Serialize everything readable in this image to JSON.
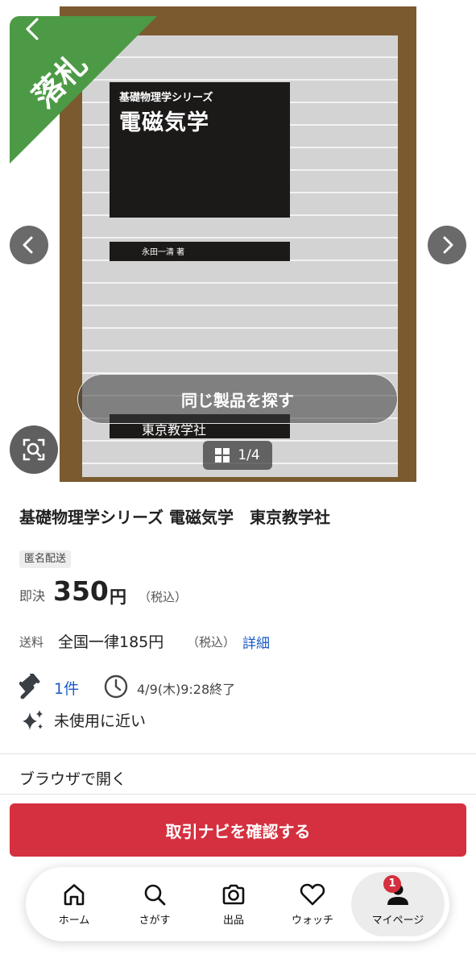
{
  "gallery": {
    "sold_badge": "落札",
    "book": {
      "series": "基礎物理学シリーズ",
      "title": "電磁気学",
      "author": "永田一清 著",
      "publisher": "東京教学社"
    },
    "same_product_button": "同じ製品を探す",
    "counter": "1/4"
  },
  "item": {
    "title": "基礎物理学シリーズ 電磁気学　東京教学社",
    "anonymous_badge": "匿名配送",
    "buyout_label": "即決",
    "price": "350",
    "price_unit": "円",
    "price_tax": "（税込）",
    "shipping_label": "送料",
    "shipping_value": "全国一律185円",
    "shipping_tax": "（税込）",
    "shipping_detail_link": "詳細",
    "bid_count": "1件",
    "end_time": "4/9(木)9:28終了",
    "condition": "未使用に近い"
  },
  "open_in_browser": "ブラウザで開く",
  "trade_nav_button": "取引ナビを確認する",
  "tabs": [
    {
      "label": "ホーム",
      "icon": "home-icon"
    },
    {
      "label": "さがす",
      "icon": "search-icon"
    },
    {
      "label": "出品",
      "icon": "camera-icon"
    },
    {
      "label": "ウォッチ",
      "icon": "heart-icon"
    },
    {
      "label": "マイページ",
      "icon": "person-icon"
    }
  ],
  "mypage_badge": "1",
  "colors": {
    "sold_badge": "#4c9a45",
    "accent_red": "#d5303f",
    "link_blue": "#1a5bc7"
  }
}
